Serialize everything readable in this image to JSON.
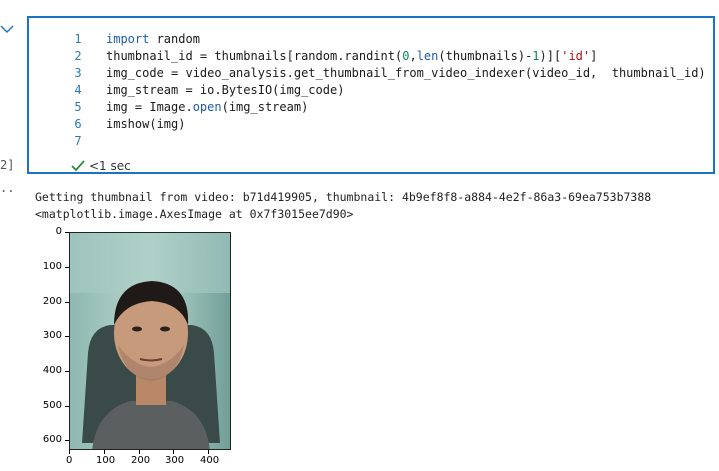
{
  "cell": {
    "execution_count": "2]",
    "output_prompt": "..",
    "line_numbers": [
      "1",
      "2",
      "3",
      "4",
      "5",
      "6",
      "7"
    ],
    "code": {
      "l1_kw": "import",
      "l1_rest": " random",
      "l2_a": "thumbnail_id = thumbnails[random.randint(",
      "l2_num0": "0",
      "l2_b": ",",
      "l2_fn": "len",
      "l2_c": "(thumbnails)-",
      "l2_num1": "1",
      "l2_d": ")][",
      "l2_str": "'id'",
      "l2_e": "]",
      "l3": "img_code = video_analysis.get_thumbnail_from_video_indexer(video_id,  thumbnail_id)",
      "l4": "img_stream = io.BytesIO(img_code)",
      "l5_a": "img = Image.",
      "l5_fn": "open",
      "l5_b": "(img_stream)",
      "l6": "imshow(img)"
    },
    "status_text": "<1 sec",
    "status_color": "#2a8c3c"
  },
  "output": {
    "line1": "Getting thumbnail from video: b71d419905, thumbnail: 4b9ef8f8-a884-4e2f-86a3-69ea753b7388",
    "line2": "<matplotlib.image.AxesImage at 0x7f3015ee7d90>"
  },
  "plot": {
    "image_description_icon": "portrait-photo",
    "y_ticks": [
      "0",
      "100",
      "200",
      "300",
      "400",
      "500",
      "600"
    ],
    "x_ticks": [
      "0",
      "100",
      "200",
      "300",
      "400"
    ]
  },
  "colors": {
    "cell_border": "#1a73c8",
    "chevron": "#1a73c8"
  }
}
